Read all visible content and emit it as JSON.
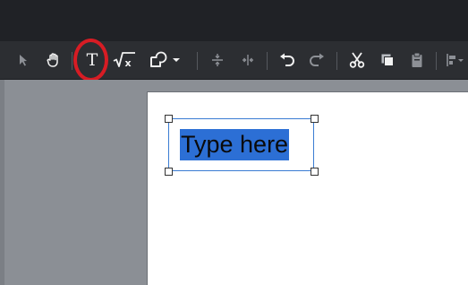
{
  "toolbar": {
    "buttons": [
      {
        "name": "select-tool",
        "icon": "arrow-cursor-icon"
      },
      {
        "name": "pan-tool",
        "icon": "hand-icon"
      },
      {
        "name": "text-tool",
        "icon": "text-icon",
        "label": "T",
        "highlighted": true
      },
      {
        "name": "equation-tool",
        "icon": "sqrt-x-icon",
        "label": "√x"
      },
      {
        "name": "shapes-tool",
        "icon": "shapes-icon"
      },
      {
        "name": "distribute-vertical",
        "icon": "distribute-vertical-icon"
      },
      {
        "name": "distribute-horizontal",
        "icon": "distribute-horizontal-icon"
      },
      {
        "name": "undo",
        "icon": "undo-icon"
      },
      {
        "name": "redo",
        "icon": "redo-icon"
      },
      {
        "name": "cut",
        "icon": "scissors-icon"
      },
      {
        "name": "copy",
        "icon": "copy-icon"
      },
      {
        "name": "paste",
        "icon": "clipboard-icon"
      },
      {
        "name": "align",
        "icon": "align-icon"
      }
    ]
  },
  "canvas": {
    "textbox": {
      "text": "Type here",
      "selected": true
    }
  },
  "colors": {
    "highlight_ring": "#d71c24",
    "selection": "#2c6fd5",
    "toolbar_bg": "#2c2e32",
    "workspace_bg": "#8b8f95"
  }
}
